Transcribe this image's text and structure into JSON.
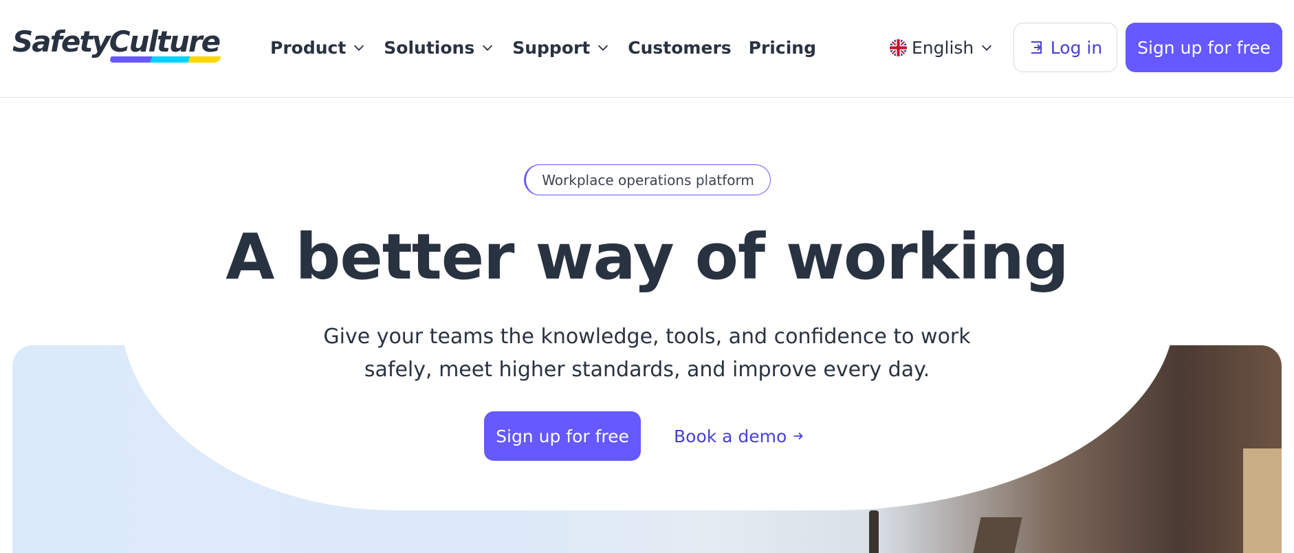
{
  "brand": {
    "logo_text": "SafetyCulture",
    "underline_colors": [
      "#6559ff",
      "#00d1ff",
      "#ffd700"
    ]
  },
  "nav": {
    "items": [
      {
        "label": "Product",
        "has_dropdown": true
      },
      {
        "label": "Solutions",
        "has_dropdown": true
      },
      {
        "label": "Support",
        "has_dropdown": true
      },
      {
        "label": "Customers",
        "has_dropdown": false
      },
      {
        "label": "Pricing",
        "has_dropdown": false
      }
    ]
  },
  "header": {
    "language": "English",
    "language_icon": "uk-flag-icon",
    "login_label": "Log in",
    "login_icon": "login-icon",
    "signup_label": "Sign up for free"
  },
  "hero": {
    "tag": "Workplace operations platform",
    "headline": "A better way of working",
    "subtitle_line1": "Give your teams the knowledge, tools, and confidence to work",
    "subtitle_line2": "safely, meet higher standards, and improve every day.",
    "primary_cta": "Sign up for free",
    "secondary_cta": "Book a demo"
  },
  "colors": {
    "accent": "#6559ff",
    "link": "#4740d4",
    "text": "#293241",
    "hero_bg": "#dbeafb"
  }
}
